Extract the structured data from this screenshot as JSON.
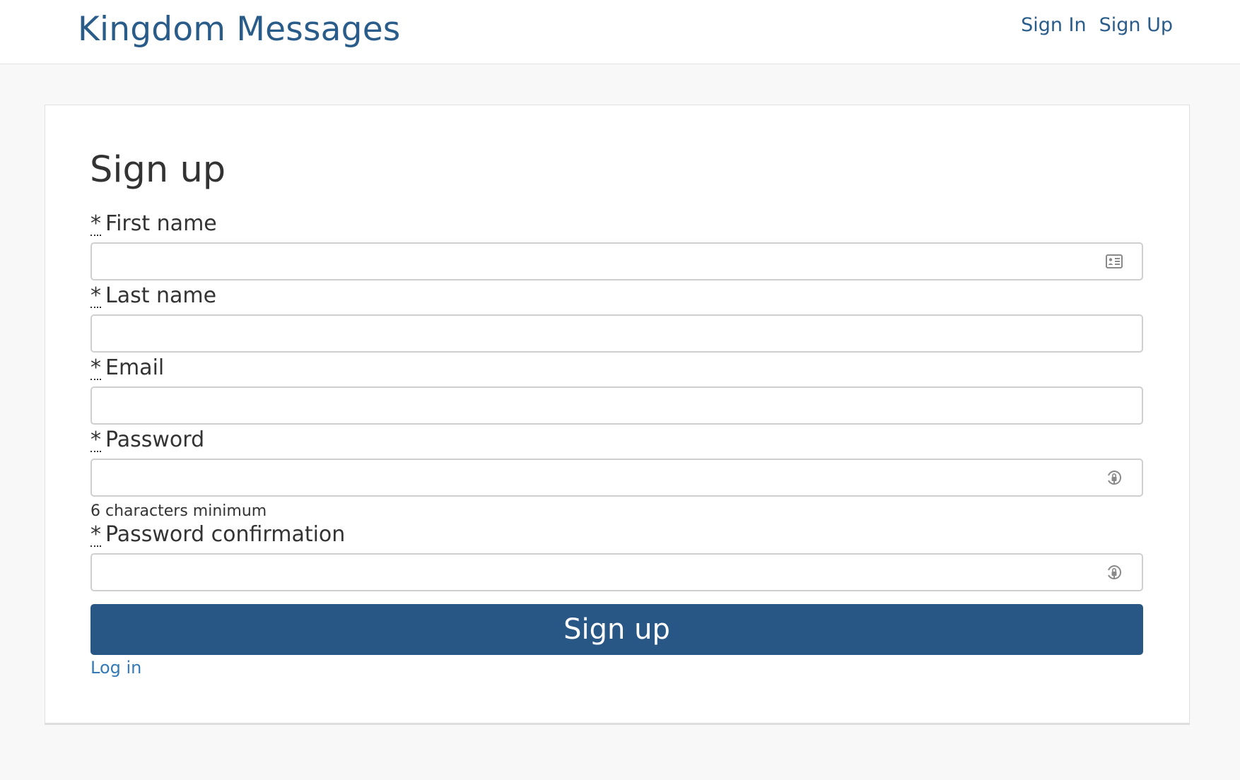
{
  "navbar": {
    "brand": "Kingdom Messages",
    "links": [
      {
        "label": "Sign In"
      },
      {
        "label": "Sign Up"
      }
    ]
  },
  "form": {
    "title": "Sign up",
    "required_marker": "*",
    "fields": [
      {
        "label": "First name",
        "value": "",
        "icon": "contact-card-icon"
      },
      {
        "label": "Last name",
        "value": ""
      },
      {
        "label": "Email",
        "value": ""
      },
      {
        "label": "Password",
        "value": "",
        "icon": "password-manager-icon",
        "hint": "6 characters minimum"
      },
      {
        "label": "Password confirmation",
        "value": "",
        "icon": "password-manager-icon"
      }
    ],
    "submit_label": "Sign up",
    "login_link": "Log in"
  },
  "colors": {
    "brand": "#2a5c8a",
    "button": "#285785",
    "link": "#337ab7",
    "background": "#f8f8f8"
  }
}
